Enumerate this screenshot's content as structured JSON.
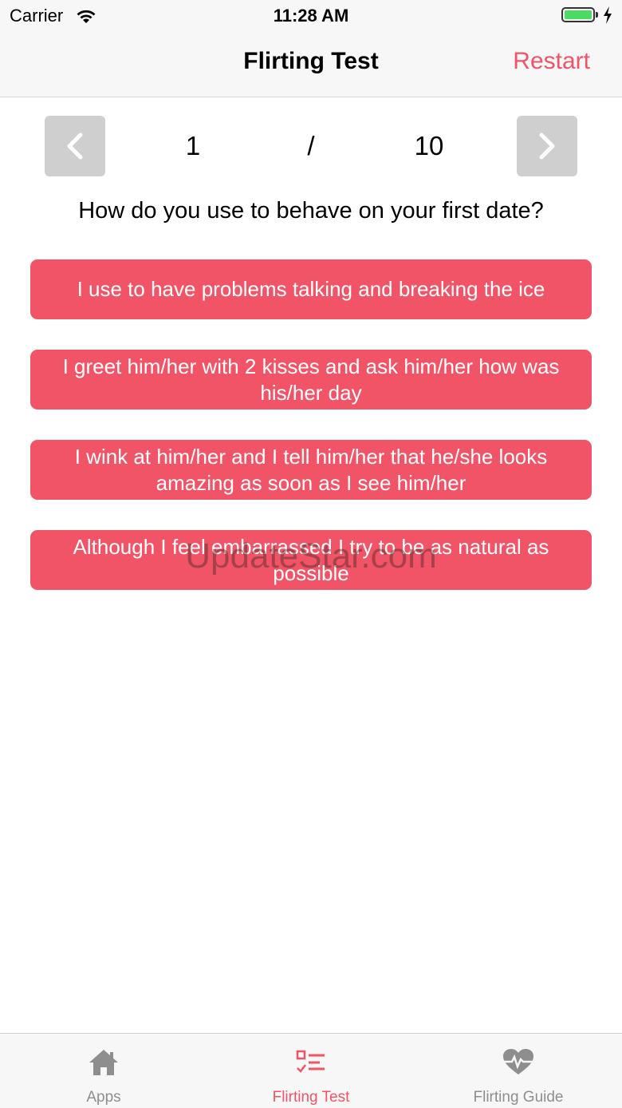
{
  "status_bar": {
    "carrier": "Carrier",
    "time": "11:28 AM"
  },
  "nav": {
    "title": "Flirting Test",
    "restart_label": "Restart"
  },
  "pager": {
    "current": "1",
    "separator": "/",
    "total": "10"
  },
  "question": "How do you use to behave on your first date?",
  "answers": [
    "I use to have problems talking and breaking the ice",
    "I greet him/her with 2 kisses and ask him/her how was his/her day",
    "I wink at him/her and I tell him/her that he/she looks amazing as soon as I see him/her",
    "Although I feel embarrassed I try to be as natural as possible"
  ],
  "watermark": "UpdateStar.com",
  "tabs": [
    {
      "label": "Apps",
      "icon": "home-icon",
      "active": false
    },
    {
      "label": "Flirting Test",
      "icon": "checklist-icon",
      "active": true
    },
    {
      "label": "Flirting Guide",
      "icon": "heartbeat-icon",
      "active": false
    }
  ],
  "colors": {
    "accent": "#f15467",
    "tab_inactive": "#8e8e8e",
    "pager_button": "#cfcfcf"
  }
}
